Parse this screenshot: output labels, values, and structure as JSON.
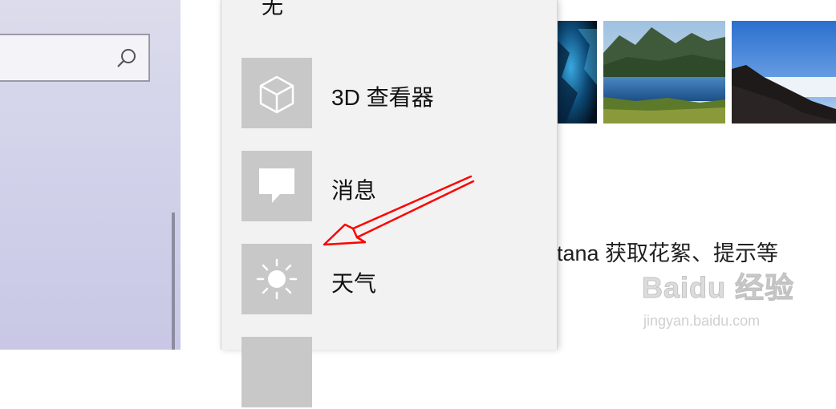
{
  "sidebar": {
    "search": {
      "placeholder": "",
      "icon": "search-icon"
    }
  },
  "flyout": {
    "partial_top_label": "无",
    "items": [
      {
        "label": "3D 查看器",
        "icon": "cube-icon"
      },
      {
        "label": "消息",
        "icon": "chat-bubble-icon"
      },
      {
        "label": "天气",
        "icon": "sun-icon"
      },
      {
        "label": "",
        "icon": "partial-app-icon"
      }
    ],
    "icon_tile_color": "#c8c8c8"
  },
  "main": {
    "description_partial": "rtana 获取花絮、提示等"
  },
  "watermark": {
    "main": "Baidu 经验",
    "sub": "jingyan.baidu.com"
  },
  "annotation": {
    "arrow_color": "#ff0000"
  }
}
